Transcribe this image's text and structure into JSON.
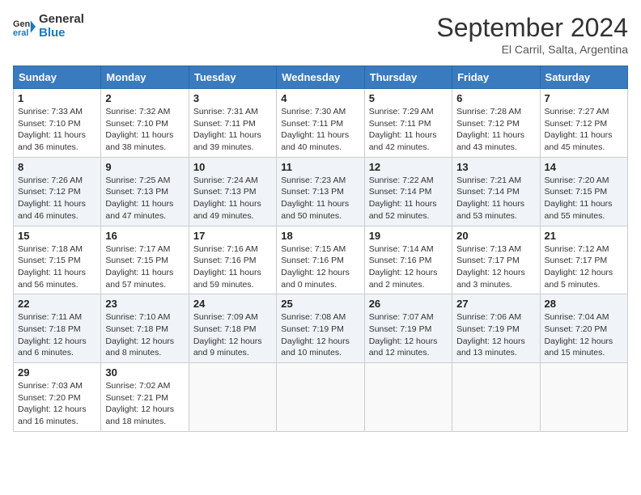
{
  "header": {
    "logo_line1": "General",
    "logo_line2": "Blue",
    "month": "September 2024",
    "location": "El Carril, Salta, Argentina"
  },
  "weekdays": [
    "Sunday",
    "Monday",
    "Tuesday",
    "Wednesday",
    "Thursday",
    "Friday",
    "Saturday"
  ],
  "weeks": [
    [
      {
        "day": "1",
        "sunrise": "7:33 AM",
        "sunset": "7:10 PM",
        "daylight": "11 hours and 36 minutes."
      },
      {
        "day": "2",
        "sunrise": "7:32 AM",
        "sunset": "7:10 PM",
        "daylight": "11 hours and 38 minutes."
      },
      {
        "day": "3",
        "sunrise": "7:31 AM",
        "sunset": "7:11 PM",
        "daylight": "11 hours and 39 minutes."
      },
      {
        "day": "4",
        "sunrise": "7:30 AM",
        "sunset": "7:11 PM",
        "daylight": "11 hours and 40 minutes."
      },
      {
        "day": "5",
        "sunrise": "7:29 AM",
        "sunset": "7:11 PM",
        "daylight": "11 hours and 42 minutes."
      },
      {
        "day": "6",
        "sunrise": "7:28 AM",
        "sunset": "7:12 PM",
        "daylight": "11 hours and 43 minutes."
      },
      {
        "day": "7",
        "sunrise": "7:27 AM",
        "sunset": "7:12 PM",
        "daylight": "11 hours and 45 minutes."
      }
    ],
    [
      {
        "day": "8",
        "sunrise": "7:26 AM",
        "sunset": "7:12 PM",
        "daylight": "11 hours and 46 minutes."
      },
      {
        "day": "9",
        "sunrise": "7:25 AM",
        "sunset": "7:13 PM",
        "daylight": "11 hours and 47 minutes."
      },
      {
        "day": "10",
        "sunrise": "7:24 AM",
        "sunset": "7:13 PM",
        "daylight": "11 hours and 49 minutes."
      },
      {
        "day": "11",
        "sunrise": "7:23 AM",
        "sunset": "7:13 PM",
        "daylight": "11 hours and 50 minutes."
      },
      {
        "day": "12",
        "sunrise": "7:22 AM",
        "sunset": "7:14 PM",
        "daylight": "11 hours and 52 minutes."
      },
      {
        "day": "13",
        "sunrise": "7:21 AM",
        "sunset": "7:14 PM",
        "daylight": "11 hours and 53 minutes."
      },
      {
        "day": "14",
        "sunrise": "7:20 AM",
        "sunset": "7:15 PM",
        "daylight": "11 hours and 55 minutes."
      }
    ],
    [
      {
        "day": "15",
        "sunrise": "7:18 AM",
        "sunset": "7:15 PM",
        "daylight": "11 hours and 56 minutes."
      },
      {
        "day": "16",
        "sunrise": "7:17 AM",
        "sunset": "7:15 PM",
        "daylight": "11 hours and 57 minutes."
      },
      {
        "day": "17",
        "sunrise": "7:16 AM",
        "sunset": "7:16 PM",
        "daylight": "11 hours and 59 minutes."
      },
      {
        "day": "18",
        "sunrise": "7:15 AM",
        "sunset": "7:16 PM",
        "daylight": "12 hours and 0 minutes."
      },
      {
        "day": "19",
        "sunrise": "7:14 AM",
        "sunset": "7:16 PM",
        "daylight": "12 hours and 2 minutes."
      },
      {
        "day": "20",
        "sunrise": "7:13 AM",
        "sunset": "7:17 PM",
        "daylight": "12 hours and 3 minutes."
      },
      {
        "day": "21",
        "sunrise": "7:12 AM",
        "sunset": "7:17 PM",
        "daylight": "12 hours and 5 minutes."
      }
    ],
    [
      {
        "day": "22",
        "sunrise": "7:11 AM",
        "sunset": "7:18 PM",
        "daylight": "12 hours and 6 minutes."
      },
      {
        "day": "23",
        "sunrise": "7:10 AM",
        "sunset": "7:18 PM",
        "daylight": "12 hours and 8 minutes."
      },
      {
        "day": "24",
        "sunrise": "7:09 AM",
        "sunset": "7:18 PM",
        "daylight": "12 hours and 9 minutes."
      },
      {
        "day": "25",
        "sunrise": "7:08 AM",
        "sunset": "7:19 PM",
        "daylight": "12 hours and 10 minutes."
      },
      {
        "day": "26",
        "sunrise": "7:07 AM",
        "sunset": "7:19 PM",
        "daylight": "12 hours and 12 minutes."
      },
      {
        "day": "27",
        "sunrise": "7:06 AM",
        "sunset": "7:19 PM",
        "daylight": "12 hours and 13 minutes."
      },
      {
        "day": "28",
        "sunrise": "7:04 AM",
        "sunset": "7:20 PM",
        "daylight": "12 hours and 15 minutes."
      }
    ],
    [
      {
        "day": "29",
        "sunrise": "7:03 AM",
        "sunset": "7:20 PM",
        "daylight": "12 hours and 16 minutes."
      },
      {
        "day": "30",
        "sunrise": "7:02 AM",
        "sunset": "7:21 PM",
        "daylight": "12 hours and 18 minutes."
      },
      null,
      null,
      null,
      null,
      null
    ]
  ]
}
